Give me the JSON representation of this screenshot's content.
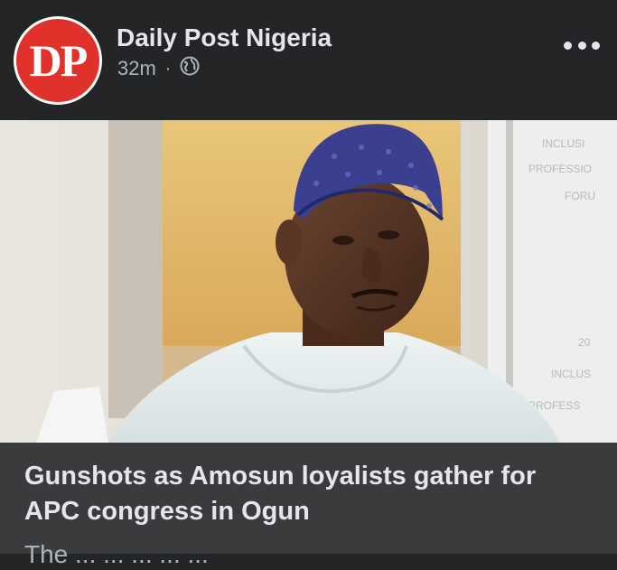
{
  "post": {
    "page_name": "Daily Post Nigeria",
    "avatar_text": "DP",
    "timestamp": "32m",
    "separator": "·",
    "privacy_icon": "globe-icon",
    "more_icon": "more-options-icon"
  },
  "article": {
    "headline": "Gunshots as Amosun loyalists gather for APC congress in Ogun",
    "subtitle": "The ... ... ... ... ..."
  },
  "colors": {
    "background": "#242526",
    "caption_background": "#3a3b3c",
    "text_primary": "#e4e6eb",
    "text_secondary": "#b0b3b8",
    "brand_red": "#e0312b"
  }
}
